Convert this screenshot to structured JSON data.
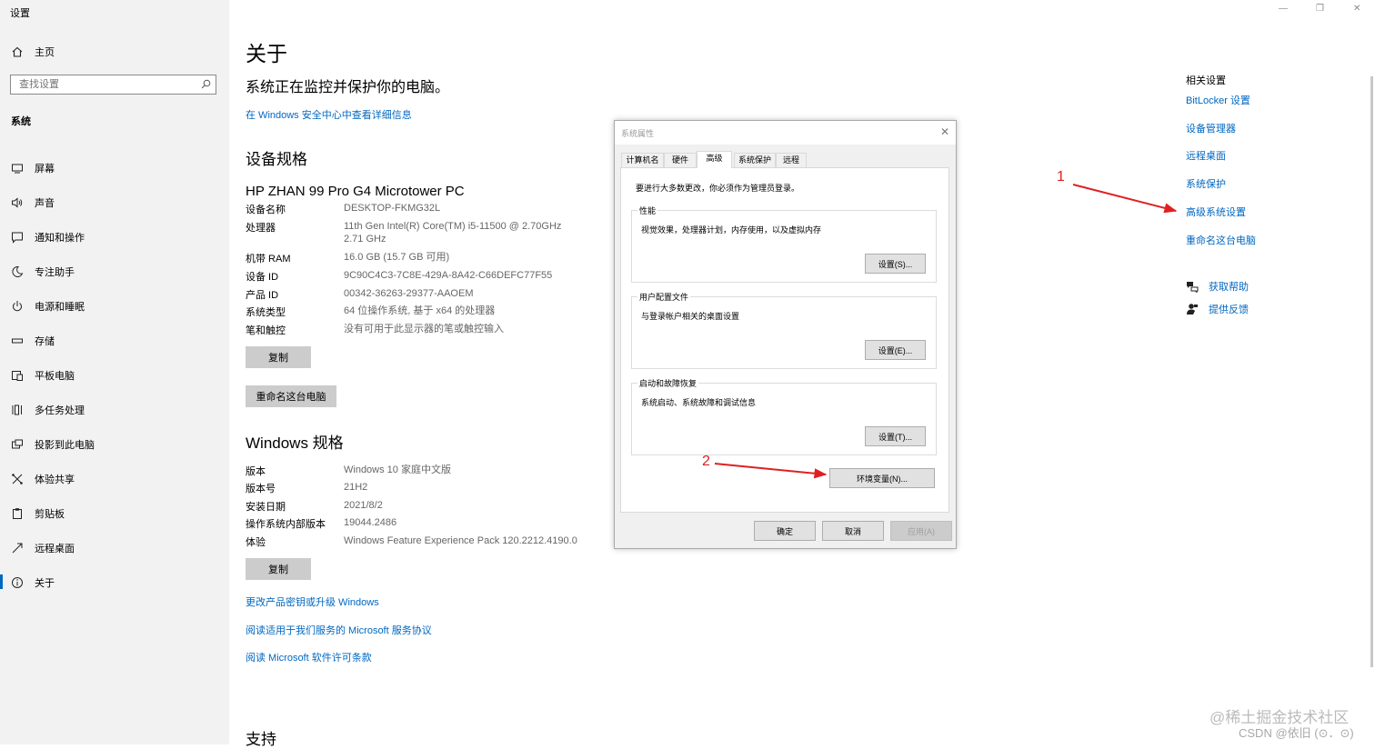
{
  "app": {
    "title": "设置"
  },
  "sidebar": {
    "home_label": "主页",
    "search_placeholder": "查找设置",
    "section_label": "系统",
    "items": [
      {
        "label": "屏幕",
        "icon": "monitor-icon"
      },
      {
        "label": "声音",
        "icon": "speaker-icon"
      },
      {
        "label": "通知和操作",
        "icon": "notification-icon"
      },
      {
        "label": "专注助手",
        "icon": "moon-icon"
      },
      {
        "label": "电源和睡眠",
        "icon": "power-icon"
      },
      {
        "label": "存储",
        "icon": "storage-icon"
      },
      {
        "label": "平板电脑",
        "icon": "tablet-icon"
      },
      {
        "label": "多任务处理",
        "icon": "multitask-icon"
      },
      {
        "label": "投影到此电脑",
        "icon": "project-icon"
      },
      {
        "label": "体验共享",
        "icon": "share-icon"
      },
      {
        "label": "剪贴板",
        "icon": "clipboard-icon"
      },
      {
        "label": "远程桌面",
        "icon": "remote-icon"
      },
      {
        "label": "关于",
        "icon": "info-icon",
        "active": true
      }
    ]
  },
  "main": {
    "title": "关于",
    "protect_text": "系统正在监控并保护你的电脑。",
    "security_link": "在 Windows 安全中心中查看详细信息",
    "device_specs": {
      "heading": "设备规格",
      "model": "HP ZHAN 99 Pro G4 Microtower PC",
      "rows": [
        {
          "key": "设备名称",
          "value": "DESKTOP-FKMG32L"
        },
        {
          "key": "处理器",
          "value": "11th Gen Intel(R) Core(TM) i5-11500 @ 2.70GHz",
          "value2": "2.71 GHz"
        },
        {
          "key": "机带 RAM",
          "value": "16.0 GB (15.7 GB 可用)"
        },
        {
          "key": "设备 ID",
          "value": "9C90C4C3-7C8E-429A-8A42-C66DEFC77F55"
        },
        {
          "key": "产品 ID",
          "value": "00342-36263-29377-AAOEM"
        },
        {
          "key": "系统类型",
          "value": "64 位操作系统, 基于 x64 的处理器"
        },
        {
          "key": "笔和触控",
          "value": "没有可用于此显示器的笔或触控输入"
        }
      ],
      "copy_label": "复制",
      "rename_label": "重命名这台电脑"
    },
    "windows_specs": {
      "heading": "Windows 规格",
      "rows": [
        {
          "key": "版本",
          "value": "Windows 10 家庭中文版"
        },
        {
          "key": "版本号",
          "value": "21H2"
        },
        {
          "key": "安装日期",
          "value": "2021/8/2"
        },
        {
          "key": "操作系统内部版本",
          "value": "19044.2486"
        },
        {
          "key": "体验",
          "value": "Windows Feature Experience Pack 120.2212.4190.0"
        }
      ],
      "copy_label": "复制"
    },
    "links": {
      "upgrade": "更改产品密钥或升级 Windows",
      "service": "阅读适用于我们服务的 Microsoft 服务协议",
      "license": "阅读 Microsoft 软件许可条款"
    },
    "support_heading": "支持"
  },
  "related": {
    "title": "相关设置",
    "links": [
      "BitLocker 设置",
      "设备管理器",
      "远程桌面",
      "系统保护",
      "高级系统设置",
      "重命名这台电脑"
    ],
    "help": "获取帮助",
    "feedback": "提供反馈"
  },
  "dialog": {
    "title": "系统属性",
    "tabs": [
      "计算机名",
      "硬件",
      "高级",
      "系统保护",
      "远程"
    ],
    "active_tab": "高级",
    "admin_note": "要进行大多数更改，你必须作为管理员登录。",
    "groups": [
      {
        "title": "性能",
        "desc": "视觉效果，处理器计划，内存使用，以及虚拟内存",
        "button": "设置(S)..."
      },
      {
        "title": "用户配置文件",
        "desc": "与登录帐户相关的桌面设置",
        "button": "设置(E)..."
      },
      {
        "title": "启动和故障恢复",
        "desc": "系统启动、系统故障和调试信息",
        "button": "设置(T)..."
      }
    ],
    "env_button": "环境变量(N)...",
    "ok": "确定",
    "cancel": "取消",
    "apply": "应用(A)"
  },
  "annotations": {
    "num1": "1",
    "num2": "2"
  },
  "watermark": {
    "line1": "@稀土掘金技术社区",
    "line2": "CSDN @依旧 (⊙．⊙)"
  },
  "colors": {
    "accent": "#0067c0",
    "arrow": "#e02020",
    "sidebar_bg": "#f2f2f2"
  }
}
